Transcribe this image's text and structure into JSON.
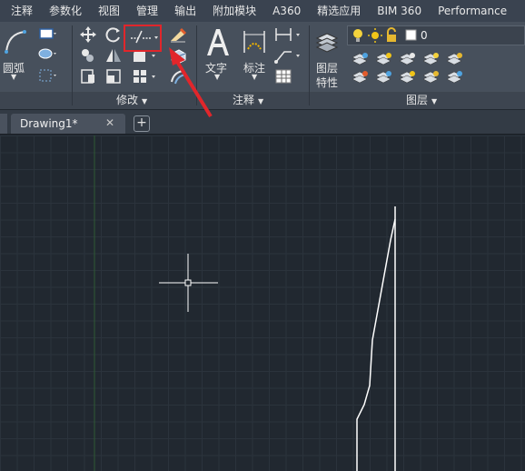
{
  "ribbon_tabs": [
    "注释",
    "参数化",
    "视图",
    "管理",
    "输出",
    "附加模块",
    "A360",
    "精选应用",
    "BIM 360",
    "Performance"
  ],
  "draw_panel": {
    "arc_label": "圆弧"
  },
  "modify_panel": {
    "title": "修改"
  },
  "annotation_panel": {
    "title": "注释",
    "text_label": "文字",
    "dimension_label": "标注"
  },
  "layers_panel": {
    "title": "图层",
    "properties_label_line1": "图层",
    "properties_label_line2": "特性",
    "current_layer": "0"
  },
  "file_tabs": {
    "active": "Drawing1*",
    "close_glyph": "✕",
    "new_glyph": "+"
  },
  "icons": [
    "arc-icon",
    "rectangle-icon",
    "hatch-icon",
    "move-icon",
    "rotate-icon",
    "trim-icon",
    "erase-icon",
    "copy-icon",
    "mirror-icon",
    "fillet-icon",
    "explode-icon",
    "stretch-icon",
    "scale-icon",
    "array-icon",
    "offset-icon",
    "text-icon",
    "dimension-icon",
    "leader-icon",
    "table-icon",
    "layer-properties-icon",
    "lightbulb-icon",
    "sun-icon",
    "lock-icon"
  ],
  "colors": {
    "highlight_box": "#e1262b",
    "arrow": "#e1262b",
    "canvas_bg": "#212830",
    "ribbon_bg": "#47505c"
  }
}
